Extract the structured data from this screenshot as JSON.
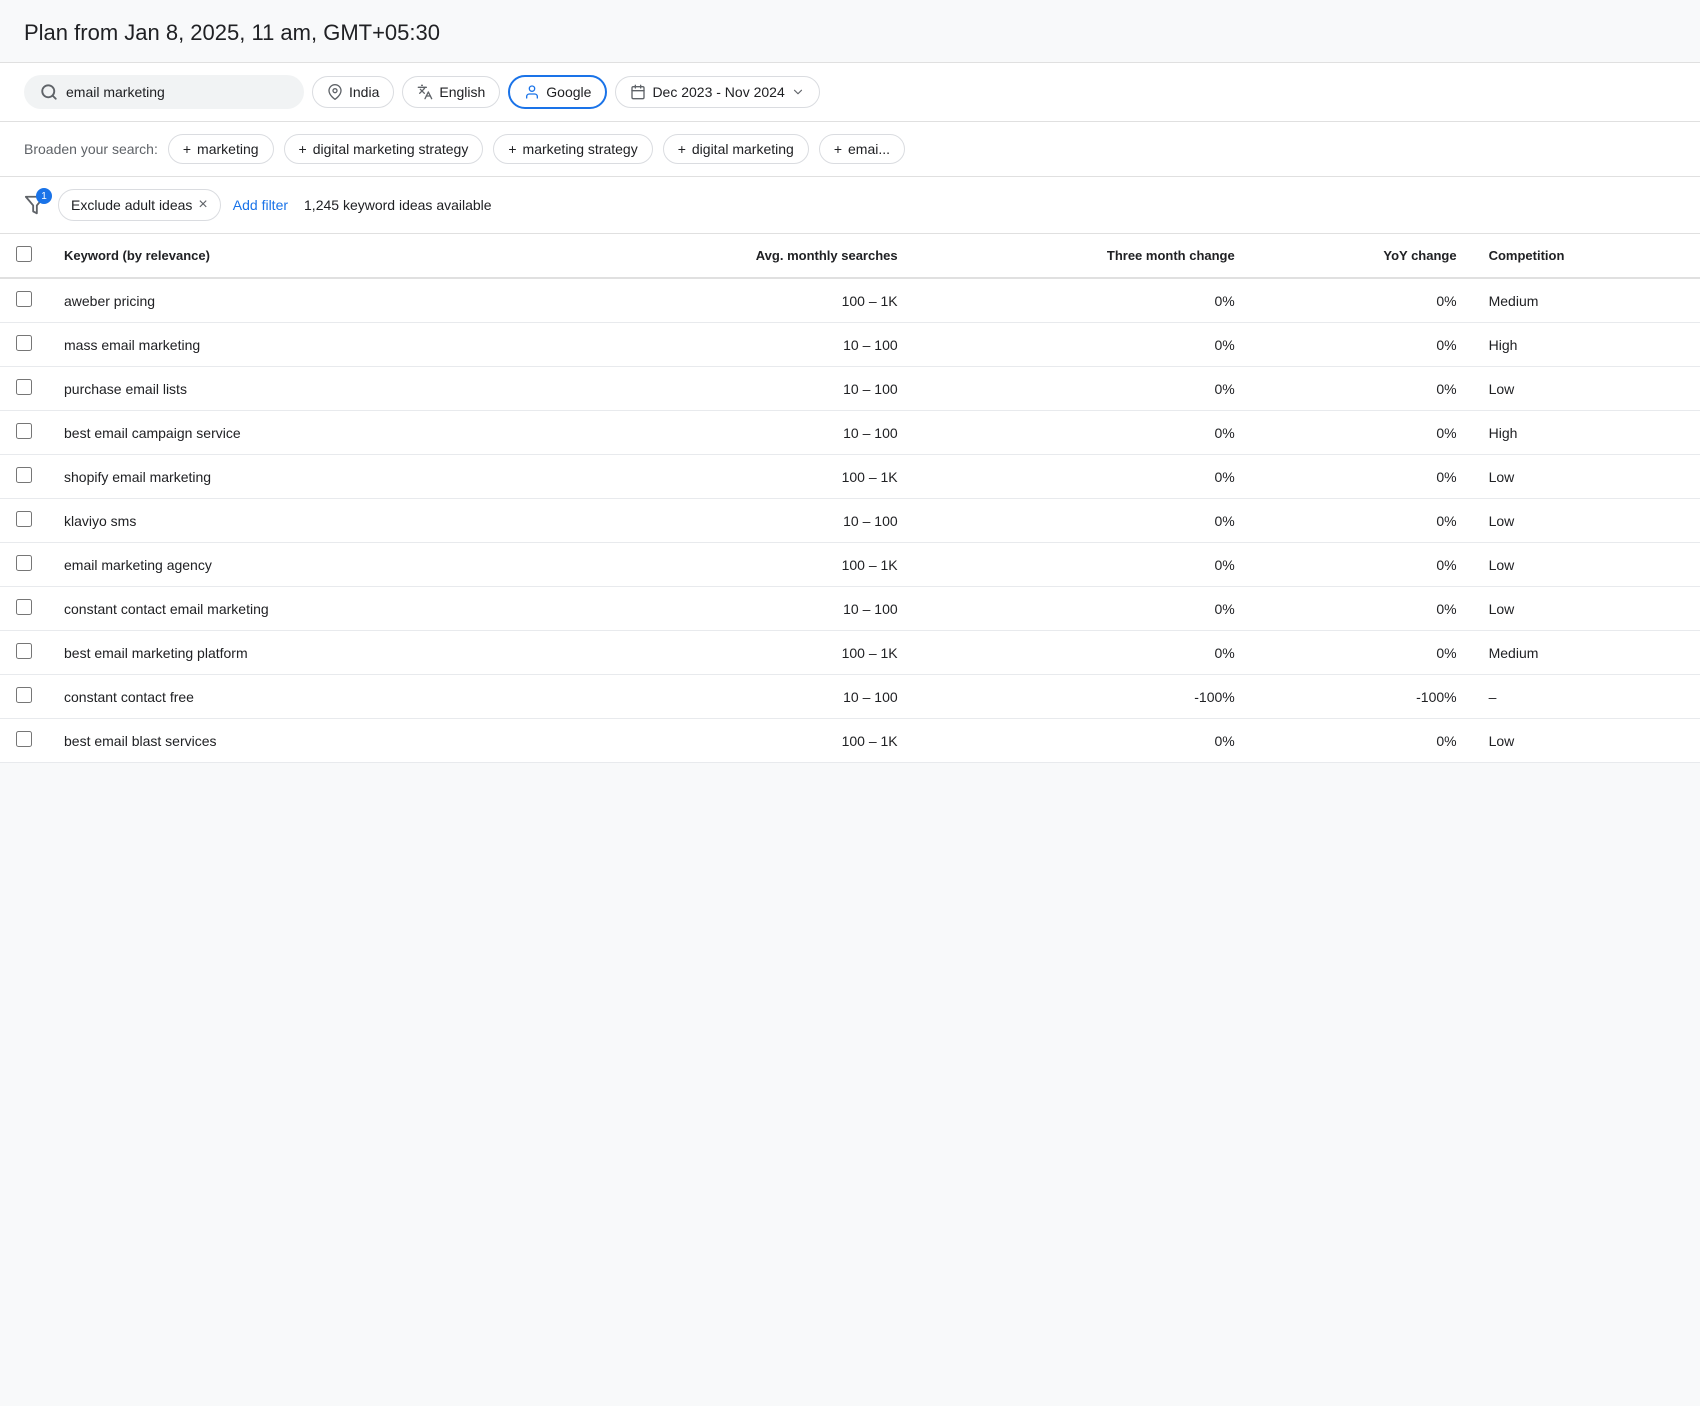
{
  "page": {
    "title": "Plan from Jan 8, 2025, 11 am, GMT+05:30"
  },
  "searchBar": {
    "query": "email marketing",
    "query_placeholder": "email marketing",
    "location": "India",
    "language": "English",
    "platform": "Google",
    "dateRange": "Dec 2023 - Nov 2024"
  },
  "broadenSearch": {
    "label": "Broaden your search:",
    "chips": [
      "marketing",
      "digital marketing strategy",
      "marketing strategy",
      "digital marketing",
      "emai..."
    ]
  },
  "filters": {
    "excludeLabel": "Exclude adult ideas",
    "addFilterLabel": "Add filter",
    "keywordCount": "1,245 keyword ideas available"
  },
  "table": {
    "headers": {
      "keyword": "Keyword (by relevance)",
      "avgMonthly": "Avg. monthly searches",
      "threeMonth": "Three month change",
      "yoy": "YoY change",
      "competition": "Competition"
    },
    "rows": [
      {
        "keyword": "aweber pricing",
        "avgMonthly": "100 – 1K",
        "threeMonth": "0%",
        "yoy": "0%",
        "competition": "Medium"
      },
      {
        "keyword": "mass email marketing",
        "avgMonthly": "10 – 100",
        "threeMonth": "0%",
        "yoy": "0%",
        "competition": "High"
      },
      {
        "keyword": "purchase email lists",
        "avgMonthly": "10 – 100",
        "threeMonth": "0%",
        "yoy": "0%",
        "competition": "Low"
      },
      {
        "keyword": "best email campaign service",
        "avgMonthly": "10 – 100",
        "threeMonth": "0%",
        "yoy": "0%",
        "competition": "High"
      },
      {
        "keyword": "shopify email marketing",
        "avgMonthly": "100 – 1K",
        "threeMonth": "0%",
        "yoy": "0%",
        "competition": "Low"
      },
      {
        "keyword": "klaviyo sms",
        "avgMonthly": "10 – 100",
        "threeMonth": "0%",
        "yoy": "0%",
        "competition": "Low"
      },
      {
        "keyword": "email marketing agency",
        "avgMonthly": "100 – 1K",
        "threeMonth": "0%",
        "yoy": "0%",
        "competition": "Low"
      },
      {
        "keyword": "constant contact email marketing",
        "avgMonthly": "10 – 100",
        "threeMonth": "0%",
        "yoy": "0%",
        "competition": "Low"
      },
      {
        "keyword": "best email marketing platform",
        "avgMonthly": "100 – 1K",
        "threeMonth": "0%",
        "yoy": "0%",
        "competition": "Medium"
      },
      {
        "keyword": "constant contact free",
        "avgMonthly": "10 – 100",
        "threeMonth": "-100%",
        "yoy": "-100%",
        "competition": "–"
      },
      {
        "keyword": "best email blast services",
        "avgMonthly": "100 – 1K",
        "threeMonth": "0%",
        "yoy": "0%",
        "competition": "Low"
      }
    ]
  },
  "icons": {
    "search": "🔍",
    "location": "📍",
    "language": "🌐",
    "platform": "👤",
    "calendar": "📅",
    "filter": "⛉",
    "plus": "+",
    "close": "×"
  }
}
